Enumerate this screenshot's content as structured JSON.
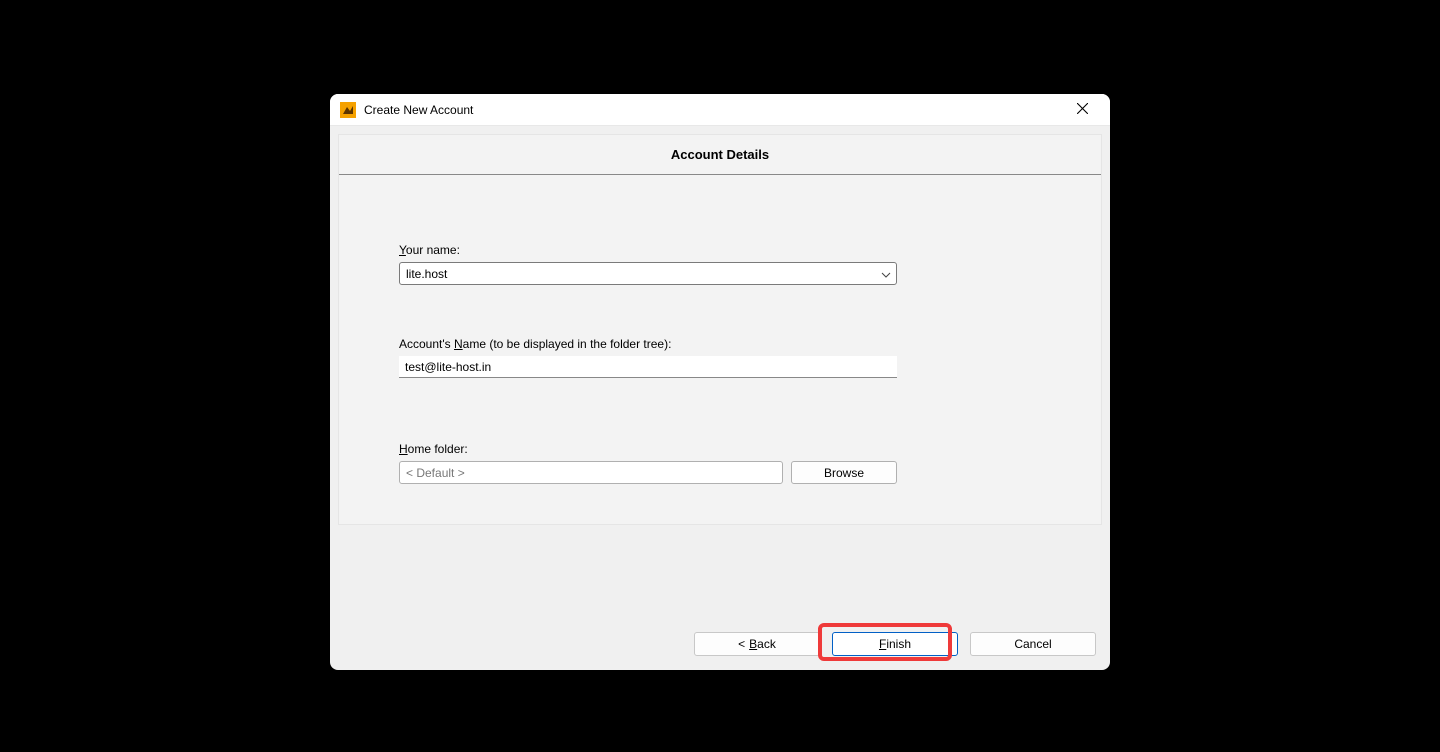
{
  "window": {
    "title": "Create New Account"
  },
  "section": {
    "heading": "Account Details"
  },
  "form": {
    "name_label_pre": "",
    "name_label_u": "Y",
    "name_label_post": "our name:",
    "name_value": "lite.host",
    "acct_label_pre": "Account's ",
    "acct_label_u": "N",
    "acct_label_post": "ame (to be displayed in the folder tree):",
    "acct_value": "test@lite-host.in",
    "home_label_u": "H",
    "home_label_post": "ome folder:",
    "home_value": "< Default >",
    "browse": "Browse"
  },
  "buttons": {
    "back_arrow": "<",
    "back_u": "B",
    "back_post": "ack",
    "finish_u": "F",
    "finish_post": "inish",
    "cancel": "Cancel"
  }
}
